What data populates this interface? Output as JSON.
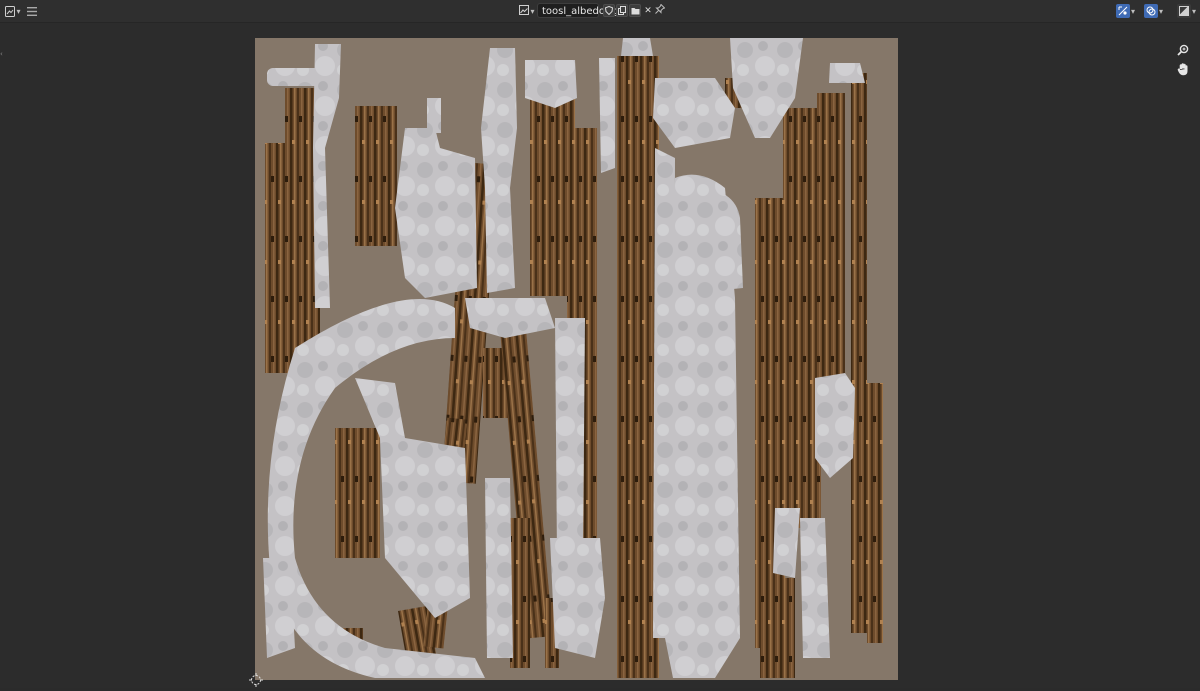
{
  "header": {
    "editor_type_icon": "image-editor-icon",
    "menu_icon": "hamburger-menu-icon",
    "image_browse_icon": "image-browse-icon",
    "image_name": "toosl_albedo.tga",
    "fake_user_icon": "shield-icon",
    "new_image_icon": "duplicate-icon",
    "open_image_icon": "folder-icon",
    "unlink_icon": "close-icon",
    "pin_icon": "pin-icon",
    "right": {
      "uv_sync_icon": "uv-sync-icon",
      "overlay_icon": "overlay-icon",
      "display_icon": "display-channels-icon"
    }
  },
  "viewport": {
    "zoom_icon": "magnifier-icon",
    "pan_icon": "hand-icon",
    "cursor_icon": "2d-cursor-icon"
  },
  "colors": {
    "background": "#2b2b2b",
    "texture_bg": "#857769",
    "metal": "#c9c8ca",
    "wood_dark": "#4a3520",
    "wood_mid": "#7a5634",
    "accent_blue": "#3f6bb5"
  }
}
